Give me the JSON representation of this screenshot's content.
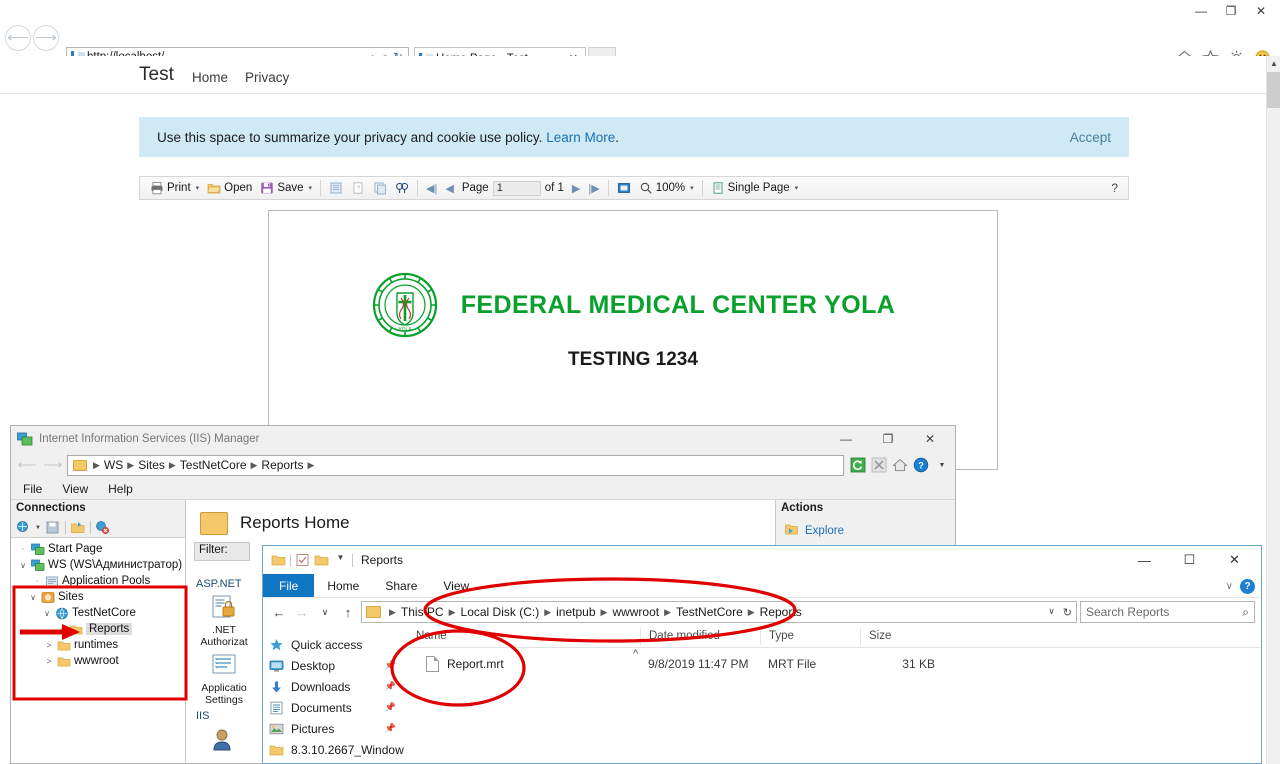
{
  "browser": {
    "url": "http://localhost/",
    "tab_title": "Home Page - Test",
    "window_controls": {
      "minimize": "—",
      "maximize": "❐",
      "close": "✕"
    },
    "icons": [
      "home-icon",
      "favorites-icon",
      "gear-icon",
      "smiley-icon"
    ],
    "search_glyph": "⌕",
    "refresh_glyph": "↻",
    "caret_glyph": "▾",
    "close_tab_glyph": "✕"
  },
  "site": {
    "brand": "Test",
    "nav": [
      "Home",
      "Privacy"
    ]
  },
  "cookie": {
    "text": "Use this space to summarize your privacy and cookie use policy.",
    "link": "Learn More",
    "period": ".",
    "accept": "Accept"
  },
  "report_toolbar": {
    "print": "Print",
    "open": "Open",
    "save": "Save",
    "page_label": "Page",
    "page_value": "1",
    "page_of": "of 1",
    "zoom": "100%",
    "view_mode": "Single Page",
    "help": "?",
    "caret": "▾"
  },
  "report_page": {
    "title": "FEDERAL MEDICAL CENTER YOLA",
    "subtitle": "TESTING 1234",
    "logo_name": "federal-medical-center-yola-logo",
    "logo_color": "#0aa02c"
  },
  "iis": {
    "window_title": "Internet Information Services (IIS) Manager",
    "breadcrumb": [
      "WS",
      "Sites",
      "TestNetCore",
      "Reports"
    ],
    "menu": [
      "File",
      "View",
      "Help"
    ],
    "connections_header": "Connections",
    "tree": [
      {
        "label": "Start Page",
        "indent": 0,
        "expander": "",
        "icon": "start-page-icon"
      },
      {
        "label": "WS (WS\\Администратор)",
        "indent": 0,
        "expander": "∨",
        "icon": "server-icon"
      },
      {
        "label": "Application Pools",
        "indent": 1,
        "expander": "",
        "icon": "app-pools-icon"
      },
      {
        "label": "Sites",
        "indent": 1,
        "expander": "∨",
        "icon": "sites-icon"
      },
      {
        "label": "TestNetCore",
        "indent": 2,
        "expander": "∨",
        "icon": "website-icon"
      },
      {
        "label": "Reports",
        "indent": 3,
        "expander": "",
        "icon": "folder-icon",
        "selected": true
      },
      {
        "label": "runtimes",
        "indent": 3,
        "expander": ">",
        "icon": "folder-icon"
      },
      {
        "label": "wwwroot",
        "indent": 3,
        "expander": ">",
        "icon": "folder-icon"
      }
    ],
    "main_header": "Reports Home",
    "filter_label": "Filter:",
    "features": [
      {
        "category": "ASP.NET"
      },
      {
        "label": ".NET\nAuthorizat",
        "icon": "net-authorization-icon"
      },
      {
        "label": "Applicatio\nSettings",
        "icon": "application-settings-icon"
      },
      {
        "category": "IIS"
      }
    ],
    "actions_header": "Actions",
    "actions": [
      {
        "label": "Explore",
        "icon": "explore-icon"
      }
    ],
    "window_controls": {
      "minimize": "—",
      "maximize": "❐",
      "close": "✕"
    },
    "toolbar_icons": [
      "refresh-icon",
      "stop-icon",
      "home-icon",
      "help-icon"
    ]
  },
  "explorer": {
    "window_title": "Reports",
    "quick_access_toolbar": [
      "folder-icon",
      "properties-icon",
      "new-folder-icon",
      "customize-caret-icon"
    ],
    "ribbon_tabs": [
      "File",
      "Home",
      "Share",
      "View"
    ],
    "breadcrumb": [
      "This PC",
      "Local Disk (C:)",
      "inetpub",
      "wwwroot",
      "TestNetCore",
      "Reports"
    ],
    "search_placeholder": "Search Reports",
    "nav_items": [
      {
        "label": "Quick access",
        "icon": "star-icon",
        "pinned": false
      },
      {
        "label": "Desktop",
        "icon": "desktop-icon",
        "pinned": true
      },
      {
        "label": "Downloads",
        "icon": "download-icon",
        "pinned": true
      },
      {
        "label": "Documents",
        "icon": "documents-icon",
        "pinned": true
      },
      {
        "label": "Pictures",
        "icon": "pictures-icon",
        "pinned": true
      },
      {
        "label": "8.3.10.2667_Window",
        "icon": "folder-icon",
        "pinned": false
      }
    ],
    "columns": [
      "Name",
      "Date modified",
      "Type",
      "Size"
    ],
    "rows": [
      {
        "name": "Report.mrt",
        "date_modified": "9/8/2019 11:47 PM",
        "type": "MRT File",
        "size": "31 KB"
      }
    ],
    "window_controls": {
      "minimize": "—",
      "maximize": "☐",
      "close": "✕"
    },
    "help_glyph": "?",
    "chevron_glyph": "∨",
    "refresh_glyph": "↻",
    "search_glyph": "⌕",
    "back_glyph": "←",
    "forward_glyph": "→",
    "up_glyph": "↑",
    "recent_glyph": "∨",
    "sort_glyph": "˄"
  },
  "annotations": {
    "color": "#e00000",
    "tree_box": "red-rectangle-around-sites-tree",
    "tree_arrow": "red-arrow-pointing-to-reports",
    "path_ellipse": "red-ellipse-around-breadcrumb-path",
    "file_ellipse": "red-ellipse-around-report-file"
  }
}
